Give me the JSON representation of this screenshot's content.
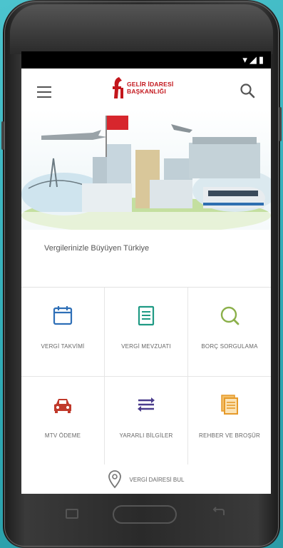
{
  "status_bar": {
    "icons": [
      "wifi-icon",
      "signal-icon",
      "battery-icon"
    ]
  },
  "app_bar": {
    "logo_line1": "GELİR İDARESİ",
    "logo_line2": "BAŞKANLIĞI"
  },
  "tagline": "Vergilerinizle Büyüyen Türkiye",
  "menu": [
    {
      "label": "VERGİ TAKVİMİ",
      "icon": "calendar-icon",
      "color": "#2e6fb7"
    },
    {
      "label": "VERGİ MEVZUATI",
      "icon": "document-icon",
      "color": "#1f9a84"
    },
    {
      "label": "BORÇ SORGULAMA",
      "icon": "magnifier-icon",
      "color": "#8bb04a"
    },
    {
      "label": "MTV ÖDEME",
      "icon": "car-icon",
      "color": "#c0392b"
    },
    {
      "label": "YARARLI BİLGİLER",
      "icon": "transfer-arrows-icon",
      "color": "#4a3c8c"
    },
    {
      "label": "REHBER VE BROŞÜR",
      "icon": "brochure-icon",
      "color": "#e69a2a"
    }
  ],
  "bottom_link": {
    "label": "VERGİ DAİRESİ BUL",
    "icon": "location-pin-icon"
  },
  "colors": {
    "brand": "#c3161c",
    "background": "#3cb5c0"
  }
}
